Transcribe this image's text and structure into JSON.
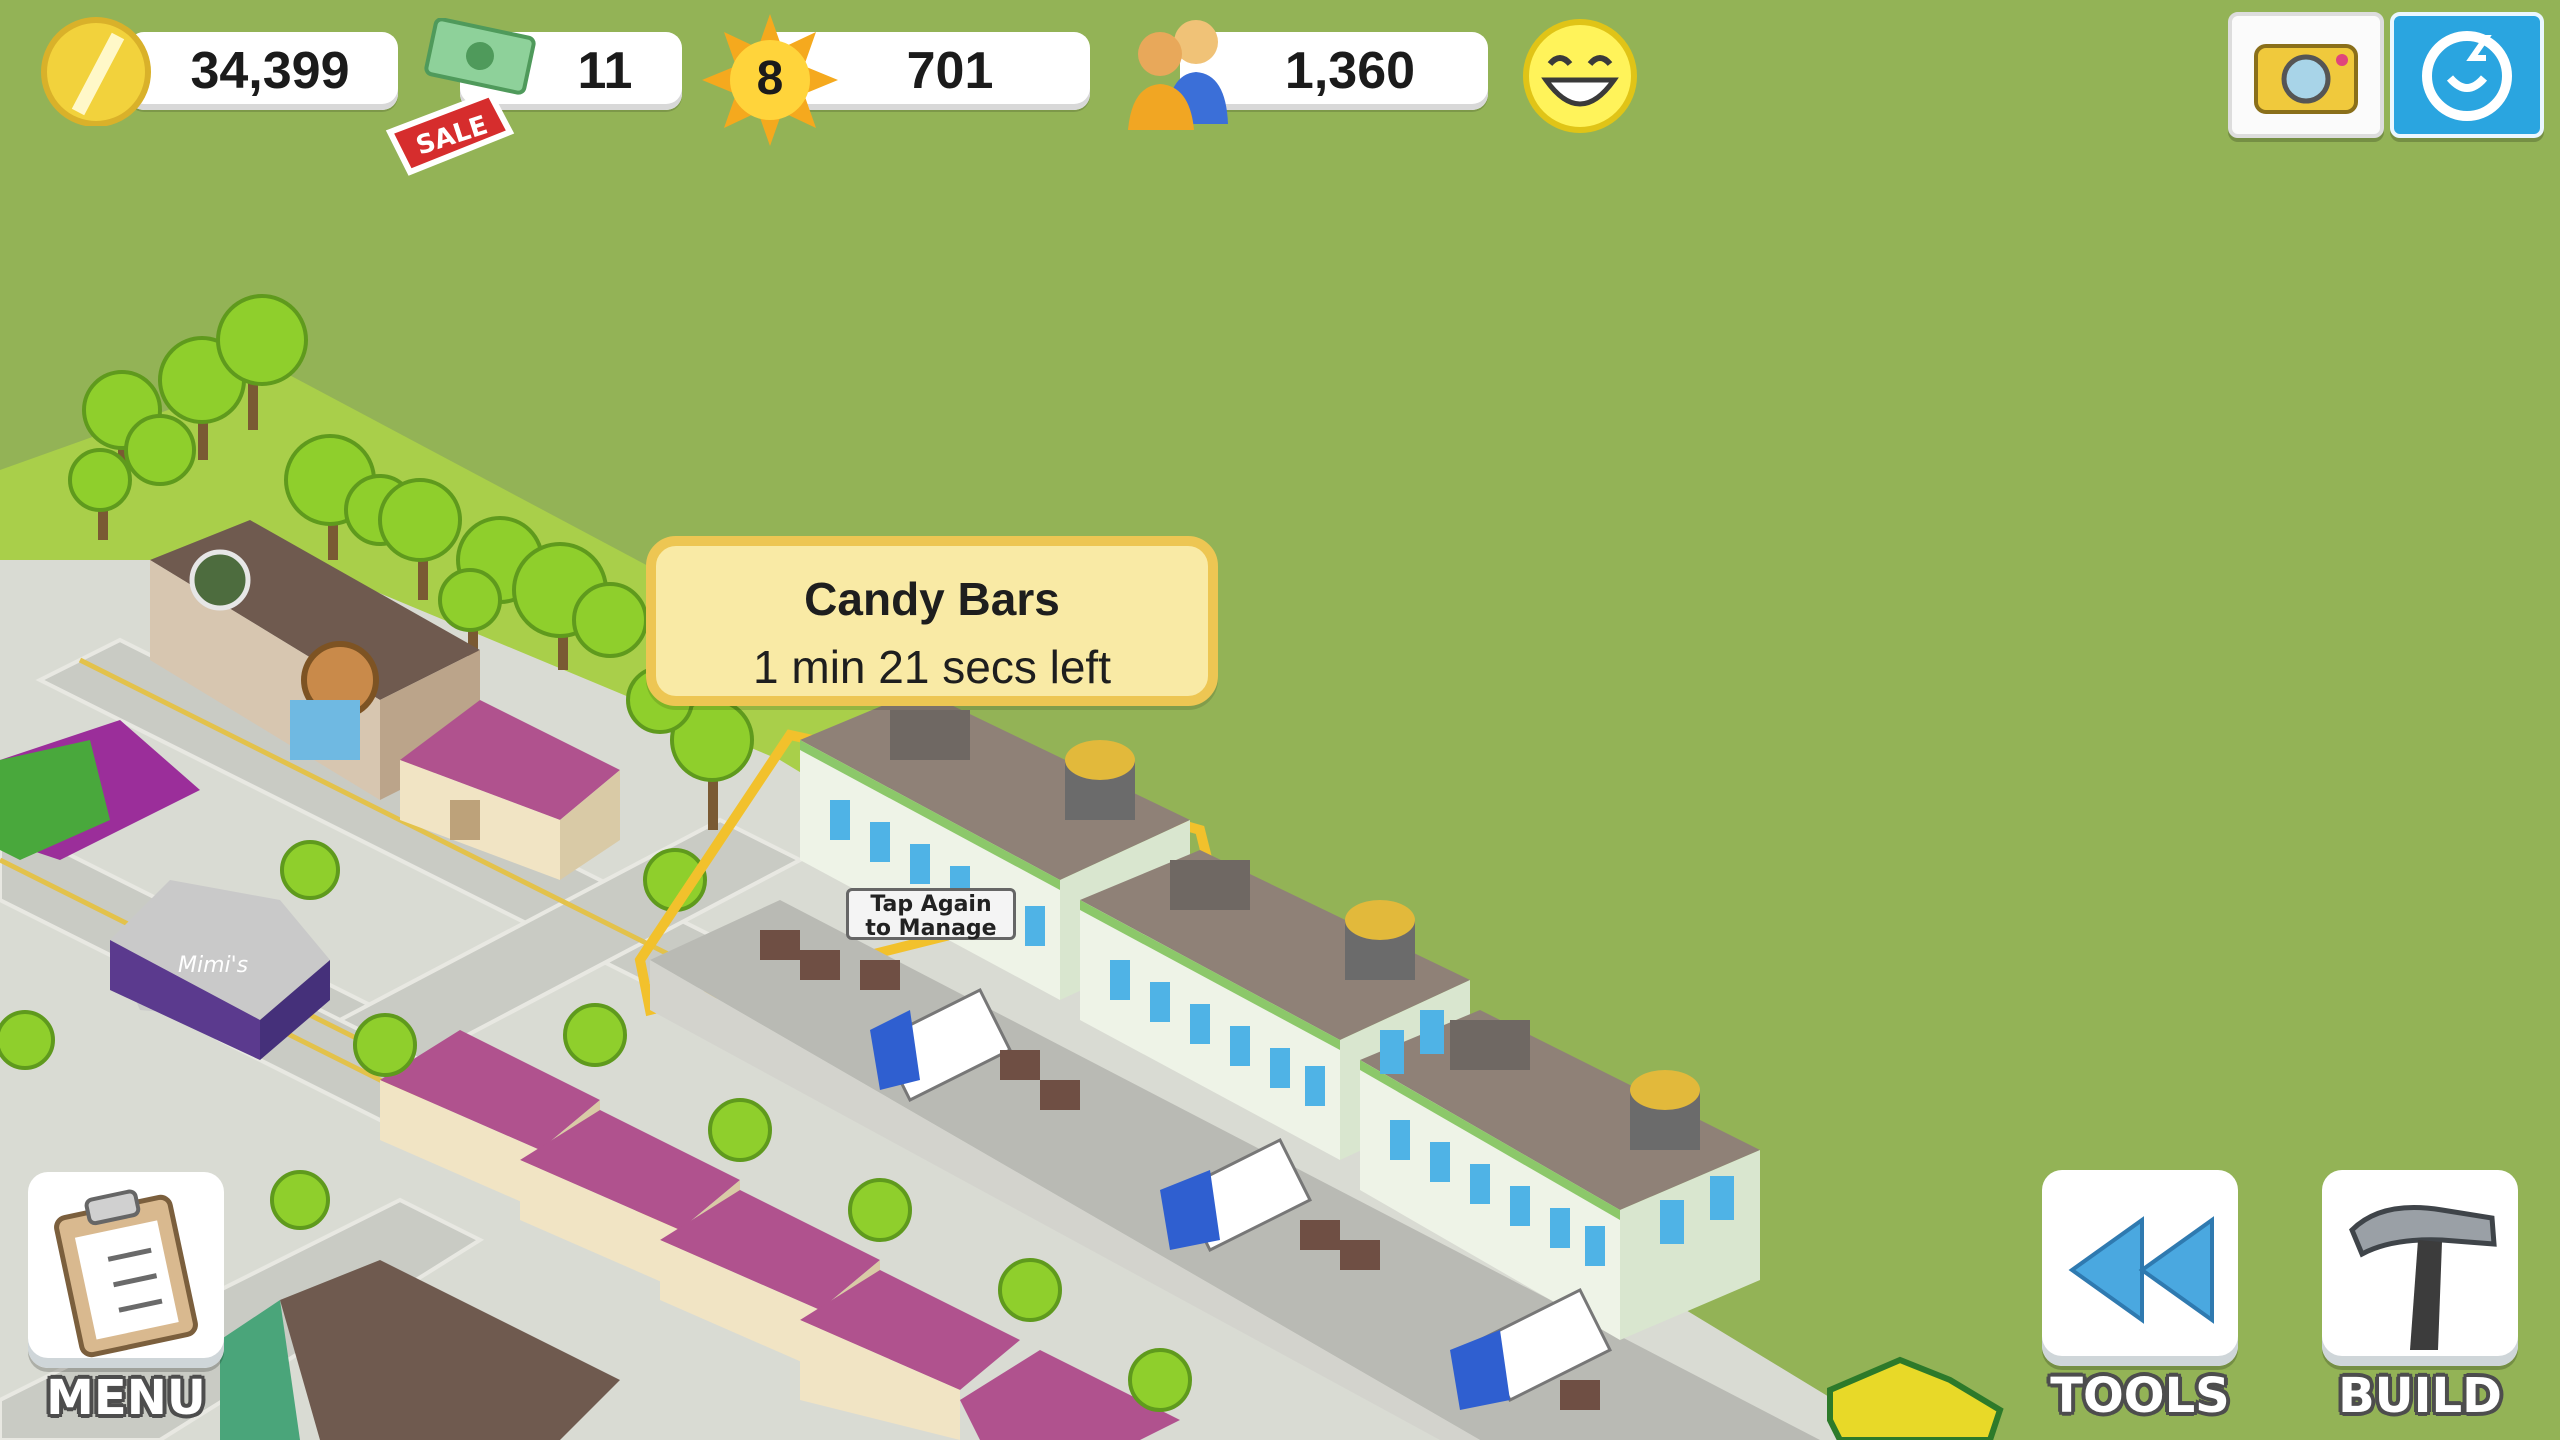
{
  "hud": {
    "coins": "34,399",
    "cash": "11",
    "sale_tag": "SALE",
    "level": "8",
    "xp": "701",
    "population": "1,360",
    "happiness_icon": "smiley-face-icon"
  },
  "top_right": {
    "camera_icon": "camera-icon",
    "facebook_icon": "friends-icon"
  },
  "tooltip": {
    "title": "Candy Bars",
    "subtitle": "1 min 21 secs left"
  },
  "building_label": {
    "line1": "Tap Again",
    "line2": "to Manage"
  },
  "shop_sign": "Mimi's",
  "bottom": {
    "menu_label": "MENU",
    "tools_label": "TOOLS",
    "build_label": "BUILD"
  },
  "colors": {
    "grass": "#93b356",
    "tooltip_bg": "#f9eaa5",
    "tooltip_border": "#edc653",
    "road": "#d7d9d0",
    "roof_pink": "#b0528e"
  }
}
